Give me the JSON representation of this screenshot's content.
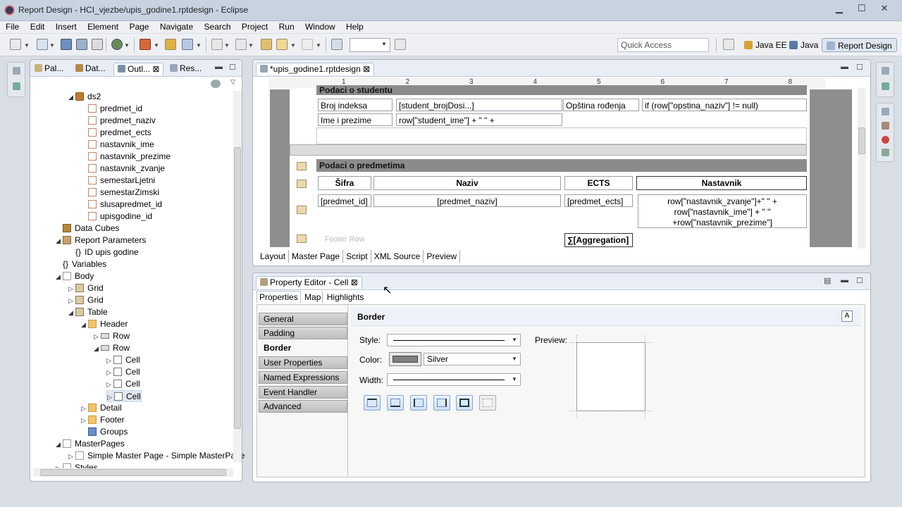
{
  "window": {
    "title": "Report Design - HCI_vjezbe/upis_godine1.rptdesign - Eclipse"
  },
  "menu": [
    "File",
    "Edit",
    "Insert",
    "Element",
    "Page",
    "Navigate",
    "Search",
    "Project",
    "Run",
    "Window",
    "Help"
  ],
  "toolbar": {
    "quick_access": "Quick Access",
    "perspectives": [
      "Java EE",
      "Java",
      "Report Design"
    ]
  },
  "left_panel": {
    "tabs": [
      "Pal...",
      "Dat...",
      "Outl...",
      "Res..."
    ],
    "close_glyph": "⊠",
    "tree": [
      {
        "label": "ds2",
        "depth": 1,
        "arrow": "◢",
        "icon": "ds"
      },
      {
        "label": "predmet_id",
        "depth": 2,
        "icon": "field"
      },
      {
        "label": "predmet_naziv",
        "depth": 2,
        "icon": "field"
      },
      {
        "label": "predmet_ects",
        "depth": 2,
        "icon": "field"
      },
      {
        "label": "nastavnik_ime",
        "depth": 2,
        "icon": "field"
      },
      {
        "label": "nastavnik_prezime",
        "depth": 2,
        "icon": "field"
      },
      {
        "label": "nastavnik_zvanje",
        "depth": 2,
        "icon": "field"
      },
      {
        "label": "semestarLjetni",
        "depth": 2,
        "icon": "field"
      },
      {
        "label": "semestarZimski",
        "depth": 2,
        "icon": "field"
      },
      {
        "label": "slusapredmet_id",
        "depth": 2,
        "icon": "field"
      },
      {
        "label": "upisgodine_id",
        "depth": 2,
        "icon": "field"
      },
      {
        "label": "Data Cubes",
        "depth": 0,
        "icon": "cube"
      },
      {
        "label": "Report Parameters",
        "depth": 0,
        "arrow": "◢",
        "icon": "param"
      },
      {
        "label": "ID upis godine",
        "depth": 1,
        "icon": "none",
        "glyph": "{}"
      },
      {
        "label": "Variables",
        "depth": 0,
        "icon": "none",
        "glyph": "{}"
      },
      {
        "label": "Body",
        "depth": 0,
        "arrow": "◢",
        "icon": "mp"
      },
      {
        "label": "Grid",
        "depth": 1,
        "arrow": "▷",
        "icon": "tbl"
      },
      {
        "label": "Grid",
        "depth": 1,
        "arrow": "▷",
        "icon": "tbl"
      },
      {
        "label": "Table",
        "depth": 1,
        "arrow": "◢",
        "icon": "tbl"
      },
      {
        "label": "Header",
        "depth": 2,
        "arrow": "◢",
        "icon": "fold"
      },
      {
        "label": "Row",
        "depth": 3,
        "arrow": "▷",
        "icon": "row"
      },
      {
        "label": "Row",
        "depth": 3,
        "arrow": "◢",
        "icon": "row"
      },
      {
        "label": "Cell",
        "depth": 4,
        "arrow": "▷",
        "icon": "cell"
      },
      {
        "label": "Cell",
        "depth": 4,
        "arrow": "▷",
        "icon": "cell"
      },
      {
        "label": "Cell",
        "depth": 4,
        "arrow": "▷",
        "icon": "cell"
      },
      {
        "label": "Cell",
        "depth": 4,
        "arrow": "▷",
        "icon": "cell",
        "selected": true
      },
      {
        "label": "Detail",
        "depth": 2,
        "arrow": "▷",
        "icon": "fold"
      },
      {
        "label": "Footer",
        "depth": 2,
        "arrow": "▷",
        "icon": "fold"
      },
      {
        "label": "Groups",
        "depth": 2,
        "icon": "grp"
      },
      {
        "label": "MasterPages",
        "depth": 0,
        "arrow": "◢",
        "icon": "mp"
      },
      {
        "label": "Simple Master Page - Simple MasterPage",
        "depth": 1,
        "arrow": "▷",
        "icon": "mp"
      },
      {
        "label": "Styles",
        "depth": 0,
        "arrow": "▷",
        "icon": "mp"
      }
    ]
  },
  "editor": {
    "tab": "*upis_godine1.rptdesign",
    "ruler_marks": [
      "1",
      "2",
      "3",
      "4",
      "5",
      "6",
      "7",
      "8"
    ],
    "section1_title": "Podaci o studentu",
    "student_cells": {
      "broj_label": "Broj indeksa",
      "broj_val": "[student_brojDosi...]",
      "opstina_label": "Opština rođenja",
      "opstina_val": "if (row[\"opstina_naziv\"] != null)",
      "ime_label": "Ime i prezime",
      "ime_val": "row[\"student_ime\"] + \" \" +"
    },
    "section2_title": "Podaci o predmetima",
    "table_headers": [
      "Šifra",
      "Naziv",
      "ECTS",
      "Nastavnik"
    ],
    "detail": {
      "sifra": "[predmet_id]",
      "naziv": "[predmet_naziv]",
      "ects": "[predmet_ects]",
      "nastavnik_lines": [
        "row[\"nastavnik_zvanje\"]+\" \" +",
        "row[\"nastavnik_ime\"] + \" \"",
        "+row[\"nastavnik_prezime\"]"
      ]
    },
    "footer": {
      "label": "Footer Row",
      "aggregation": "∑[Aggregation]"
    },
    "bottom_tabs": [
      "Layout",
      "Master Page",
      "Script",
      "XML Source",
      "Preview"
    ]
  },
  "property_editor": {
    "title": "Property Editor - Cell",
    "tabs": [
      "Properties",
      "Map",
      "Highlights"
    ],
    "categories": [
      "General",
      "Padding",
      "Border",
      "User Properties",
      "Named Expressions",
      "Event Handler",
      "Advanced"
    ],
    "active_category": "Border",
    "section_title": "Border",
    "style_label": "Style:",
    "color_label": "Color:",
    "color_value": "Silver",
    "color_swatch": "#808080",
    "width_label": "Width:",
    "preview_label": "Preview:"
  },
  "colors": {
    "accent": "#3c78c8",
    "header_gray": "#8b8b8b",
    "title_bar": "#c8d3e2"
  }
}
